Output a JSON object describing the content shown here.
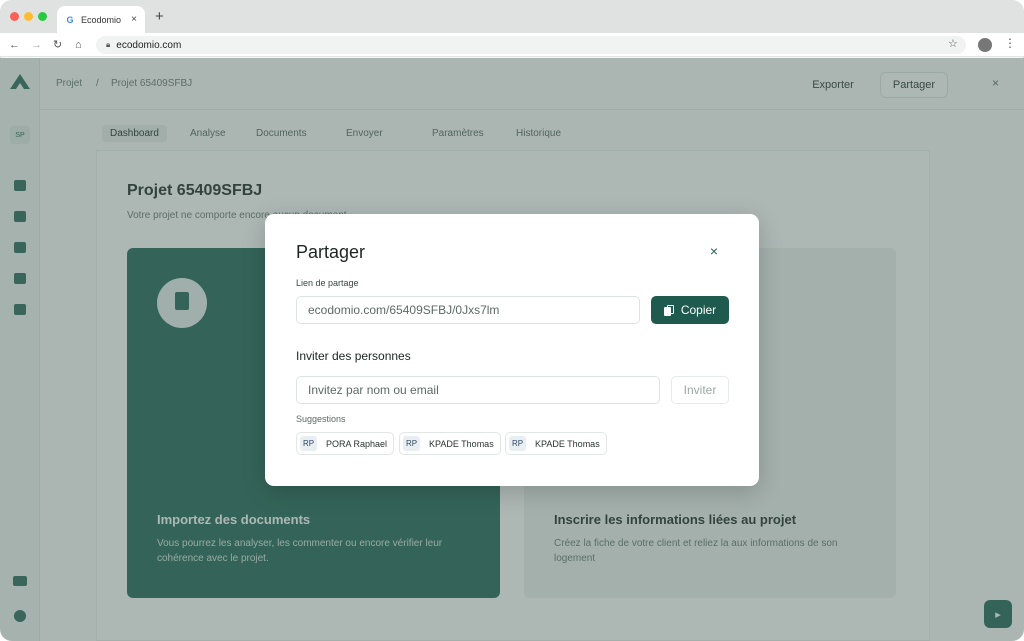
{
  "browser": {
    "tab_title": "Ecodomio",
    "tab_close": "×",
    "new_tab": "+",
    "url": "ecodomio.com",
    "back": "←",
    "forward": "→",
    "reload": "↻",
    "home": "⌂",
    "star": "☆",
    "menu": "⋮"
  },
  "app": {
    "sidebar_avatar": "SP",
    "breadcrumb": [
      "Projet",
      "/",
      "Projet 65409SFBJ"
    ],
    "export_label": "Exporter",
    "share_label": "Partager",
    "close": "×",
    "tabs": [
      "Dashboard",
      "Analyse",
      "Documents",
      "Envoyer",
      "Paramètres",
      "Historique"
    ],
    "project_title": "Projet 65409SFBJ",
    "project_subtitle": "Votre projet ne comporte encore aucun document",
    "card_import": {
      "title": "Importez des documents",
      "text": "Vous pourrez les analyser, les commenter ou encore vérifier leur cohérence avec le projet."
    },
    "card_info": {
      "title": "Inscrire les informations liées au projet",
      "text": "Créez la fiche de votre client et reliez la aux informations de son logement"
    }
  },
  "modal": {
    "title": "Partager",
    "close": "×",
    "link_label": "Lien de partage",
    "link_value": "ecodomio.com/65409SFBJ/0Jxs7lm",
    "copy_label": "Copier",
    "invite_title": "Inviter des personnes",
    "invite_placeholder": "Invitez par nom ou email",
    "invite_button": "Inviter",
    "suggestions_label": "Suggestions",
    "suggestions": [
      {
        "initials": "RP",
        "name": "PORA Raphael"
      },
      {
        "initials": "RP",
        "name": "KPADE Thomas"
      },
      {
        "initials": "RP",
        "name": "KPADE Thomas"
      }
    ]
  },
  "colors": {
    "brand": "#1e5b4e",
    "overlay": "#4a6058"
  }
}
